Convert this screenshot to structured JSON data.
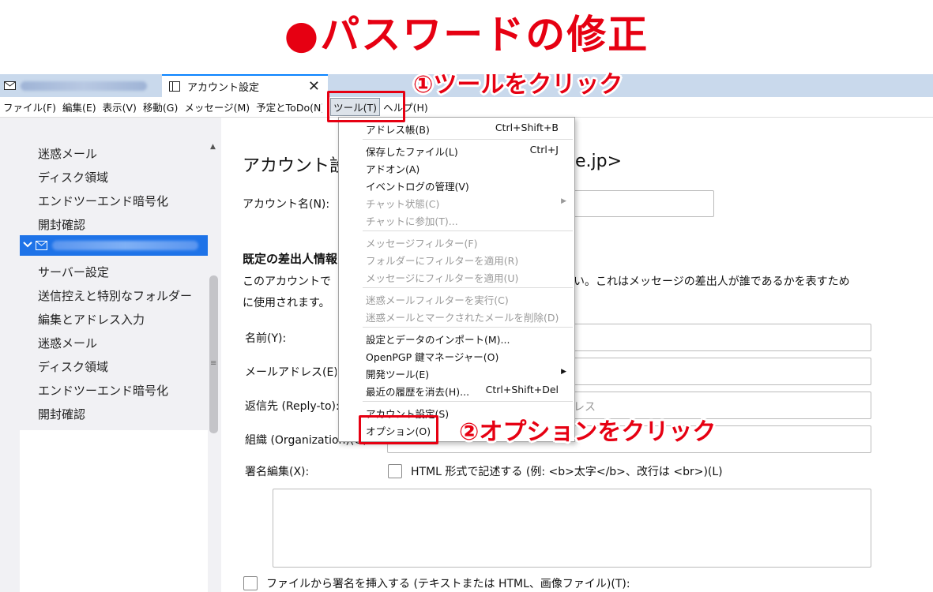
{
  "headline": "●パスワードの修正",
  "tabs": {
    "tab2_label": "アカウント設定",
    "close_glyph": "✕"
  },
  "menubar": [
    "ファイル(F)",
    "編集(E)",
    "表示(V)",
    "移動(G)",
    "メッセージ(M)",
    "予定とToDo(N)",
    "ツール(T)",
    "ヘルプ(H)"
  ],
  "sidebar": {
    "top_items": [
      "迷惑メール",
      "ディスク領域",
      "エンドツーエンド暗号化",
      "開封確認"
    ],
    "bottom_items": [
      "サーバー設定",
      "送信控えと特別なフォルダー",
      "編集とアドレス入力",
      "迷惑メール",
      "ディスク領域",
      "エンドツーエンド暗号化",
      "開封確認"
    ]
  },
  "main": {
    "title_left": "アカウント設",
    "title_right": "e.jp>",
    "account_name_label": "アカウント名(N):",
    "section_title": "既定の差出人情報",
    "desc_line1_left": "このアカウントで",
    "desc_line1_right": "い。これはメッセージの差出人が誰であるかを表すため",
    "desc_line2": "に使用されます。",
    "name_label": "名前(Y):",
    "email_label": "メールアドレス(E):",
    "replyto_label": "返信先 (Reply-to):",
    "replyto_placeholder_tail": "レス",
    "org_label": "組織 (Organization)(O):",
    "signature_label": "署名編集(X):",
    "html_checkbox_label": "HTML 形式で記述する (例: <b>太字</b>、改行は <br>)(L)",
    "file_signature_label": "ファイルから署名を挿入する (テキストまたは HTML、画像ファイル)(T):"
  },
  "dropdown": {
    "items": [
      {
        "label": "アドレス帳(B)",
        "shortcut": "Ctrl+Shift+B",
        "disabled": false
      },
      {
        "label": "保存したファイル(L)",
        "shortcut": "Ctrl+J",
        "disabled": false
      },
      {
        "label": "アドオン(A)",
        "shortcut": "",
        "disabled": false
      },
      {
        "label": "イベントログの管理(V)",
        "shortcut": "",
        "disabled": false
      },
      {
        "label": "チャット状態(C)",
        "shortcut": "",
        "disabled": true
      },
      {
        "label": "チャットに参加(T)...",
        "shortcut": "",
        "disabled": true
      },
      {
        "label": "メッセージフィルター(F)",
        "shortcut": "",
        "disabled": true
      },
      {
        "label": "フォルダーにフィルターを適用(R)",
        "shortcut": "",
        "disabled": true
      },
      {
        "label": "メッセージにフィルターを適用(U)",
        "shortcut": "",
        "disabled": true
      },
      {
        "label": "迷惑メールフィルターを実行(C)",
        "shortcut": "",
        "disabled": true
      },
      {
        "label": "迷惑メールとマークされたメールを削除(D)",
        "shortcut": "",
        "disabled": true
      },
      {
        "label": "設定とデータのインポート(M)...",
        "shortcut": "",
        "disabled": false
      },
      {
        "label": "OpenPGP 鍵マネージャー(O)",
        "shortcut": "",
        "disabled": false
      },
      {
        "label": "開発ツール(E)",
        "shortcut": "",
        "disabled": false
      },
      {
        "label": "最近の履歴を消去(H)...",
        "shortcut": "Ctrl+Shift+Del",
        "disabled": false
      },
      {
        "label": "アカウント設定(S)",
        "shortcut": "",
        "disabled": false
      },
      {
        "label": "オプション(O)",
        "shortcut": "",
        "disabled": false
      }
    ]
  },
  "annotations": {
    "step1": "①ツールをクリック",
    "step2": "②オプションをクリック"
  },
  "colors": {
    "accent_red": "#e60012",
    "selection_blue": "#1e73e8",
    "tabbar": "#c9d9ec"
  }
}
